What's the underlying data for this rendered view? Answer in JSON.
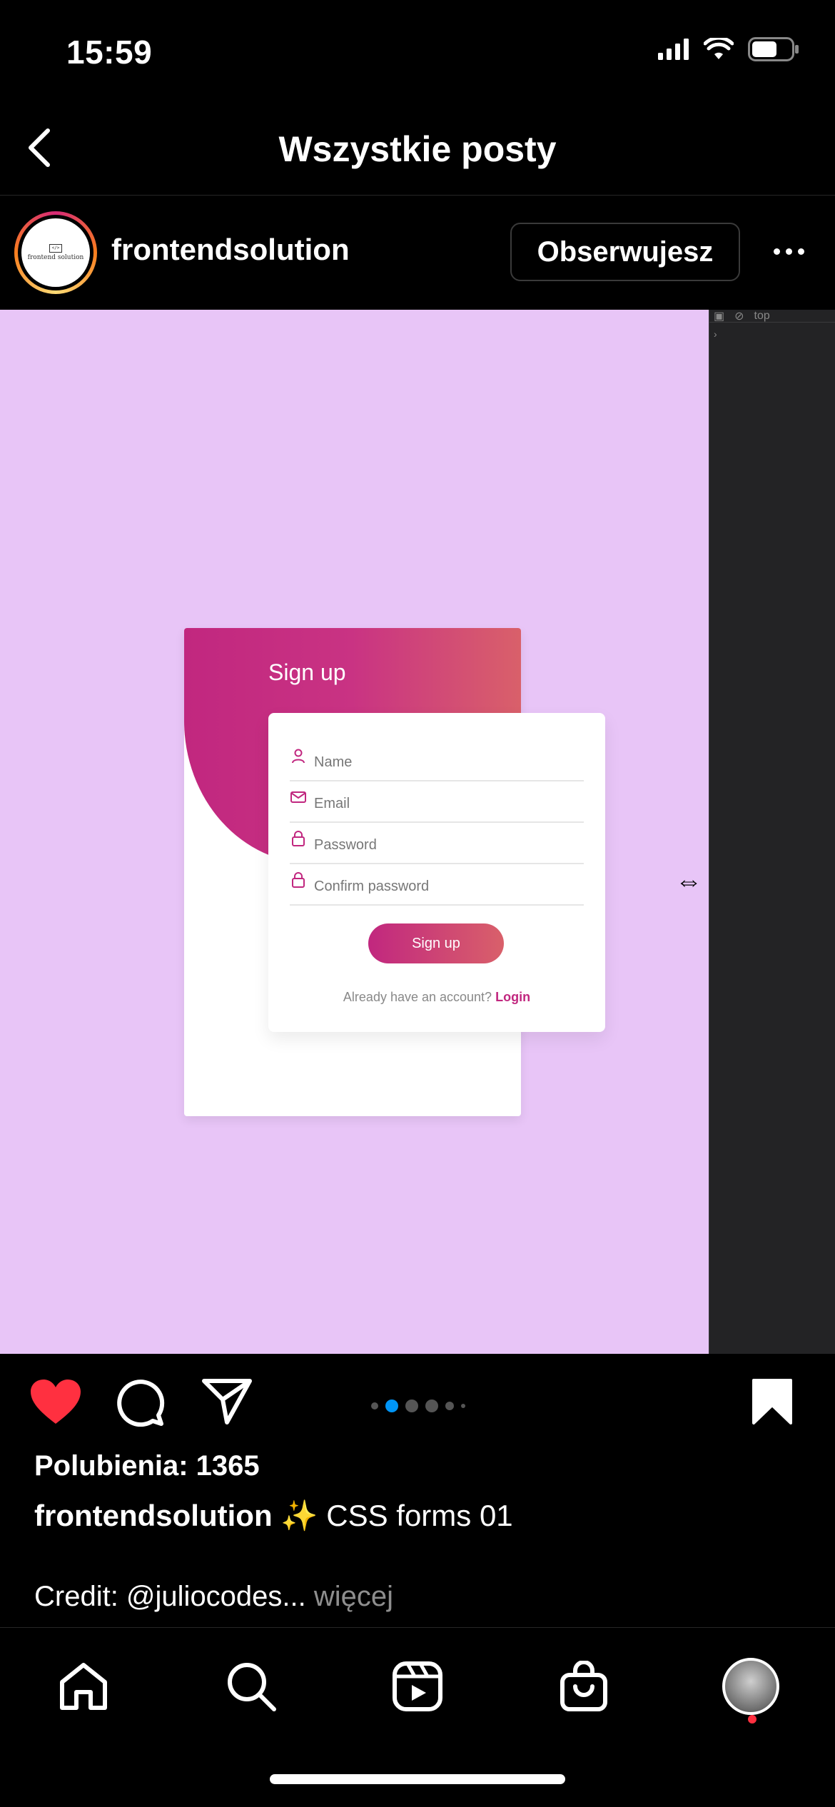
{
  "status_bar": {
    "time": "15:59"
  },
  "header": {
    "title": "Wszystkie posty"
  },
  "post": {
    "username": "frontendsolution",
    "avatar_text": "frontend solution",
    "avatar_logo": "</>",
    "follow_label": "Obserwujesz"
  },
  "media": {
    "devtools_tab": "top",
    "card_title": "Sign up",
    "fields": [
      {
        "label": "Name",
        "icon": "user-icon"
      },
      {
        "label": "Email",
        "icon": "mail-icon"
      },
      {
        "label": "Password",
        "icon": "lock-icon"
      },
      {
        "label": "Confirm password",
        "icon": "lock-icon"
      }
    ],
    "button_label": "Sign up",
    "account_text": "Already have an account?",
    "login_label": "Login",
    "colors": {
      "background": "#e8c5f7",
      "gradient_start": "#c1277f",
      "gradient_end": "#d9606a"
    }
  },
  "carousel": {
    "active_index": 1,
    "count": 6
  },
  "likes": "Polubienia: 1365",
  "caption": {
    "user": "frontendsolution",
    "emoji": "✨",
    "text": "CSS forms 01"
  },
  "credit": {
    "text": "Credit: @juliocodes...",
    "more": "więcej"
  },
  "colors": {
    "like": "#ff3040",
    "active_dot": "#0095f6"
  }
}
